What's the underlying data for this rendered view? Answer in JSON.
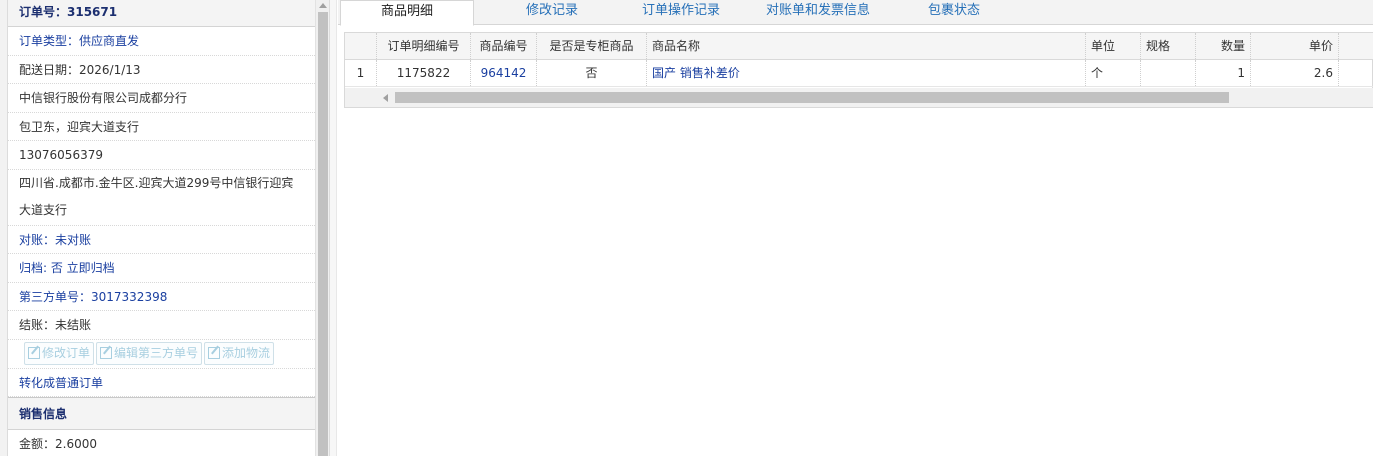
{
  "sidebar": {
    "order_no": "订单号：315671",
    "order_type": "订单类型：供应商直发",
    "delivery_date": "配送日期：2026/1/13",
    "company": "中信银行股份有限公司成都分行",
    "contact": "包卫东，迎宾大道支行",
    "phone": "13076056379",
    "address": "四川省.成都市.金牛区.迎宾大道299号中信银行迎宾大道支行",
    "reconcile": "对账：未对账",
    "archive": "归档:  否 立即归档",
    "third_party_no": "第三方单号：3017332398",
    "settlement": "结账：未结账",
    "buttons": {
      "edit_order": "修改订单",
      "edit_third_party": "编辑第三方单号",
      "add_logistics": "添加物流"
    },
    "convert_link": "转化成普通订单",
    "sales_section": "销售信息",
    "amount": "金额：2.6000"
  },
  "tabs": [
    "商品明细",
    "修改记录",
    "订单操作记录",
    "对账单和发票信息",
    "包裹状态"
  ],
  "grid": {
    "columns": [
      "订单明细编号",
      "商品编号",
      "是否是专柜商品",
      "商品名称",
      "单位",
      "规格",
      "数量",
      "单价"
    ],
    "rows": [
      {
        "row_num": "1",
        "detail_no": "1175822",
        "product_no": "964142",
        "is_counter": "否",
        "product_name": "国产 销售补差价",
        "unit": "个",
        "spec": "",
        "qty": "1",
        "price": "2.6"
      }
    ]
  }
}
